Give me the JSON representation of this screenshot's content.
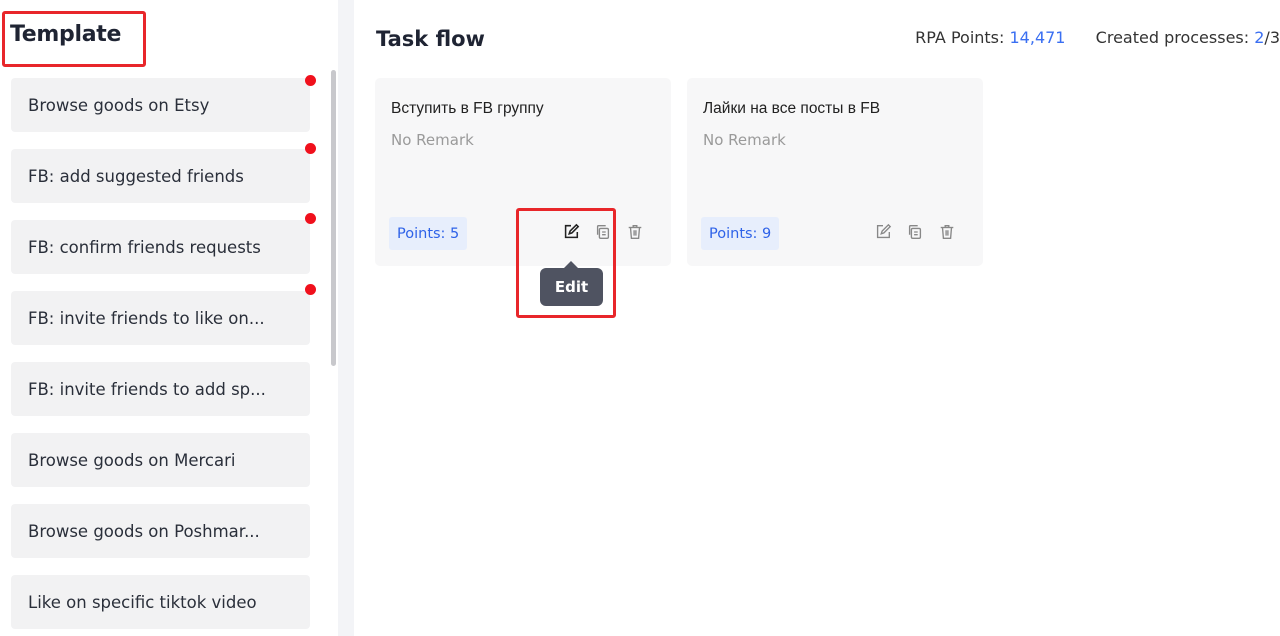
{
  "sidebar": {
    "title": "Template",
    "items": [
      {
        "label": "Browse goods on Etsy",
        "dot": true
      },
      {
        "label": "FB: add suggested friends",
        "dot": true
      },
      {
        "label": "FB: confirm friends requests",
        "dot": true
      },
      {
        "label": "FB: invite friends to like on...",
        "dot": true
      },
      {
        "label": "FB: invite friends to add sp...",
        "dot": false
      },
      {
        "label": "Browse goods on Mercari",
        "dot": false
      },
      {
        "label": "Browse goods on Poshmar...",
        "dot": false
      },
      {
        "label": "Like on specific tiktok video",
        "dot": false
      }
    ]
  },
  "main": {
    "title": "Task flow",
    "rpa_label": "RPA Points:",
    "rpa_value": "14,471",
    "created_label": "Created processes:",
    "created_value": "2",
    "created_total": "/3"
  },
  "cards": [
    {
      "title": "Вступить в FB группу",
      "remark": "No Remark",
      "points": "Points: 5"
    },
    {
      "title": "Лайки на все посты в FB",
      "remark": "No Remark",
      "points": "Points: 9"
    }
  ],
  "tooltip": {
    "label": "Edit"
  },
  "colors": {
    "accent": "#3a6ff2",
    "highlight": "#e8262a",
    "dot": "#f0101c",
    "tooltip_bg": "#4f5361"
  },
  "icons": [
    "edit-icon",
    "copy-icon",
    "delete-icon"
  ]
}
